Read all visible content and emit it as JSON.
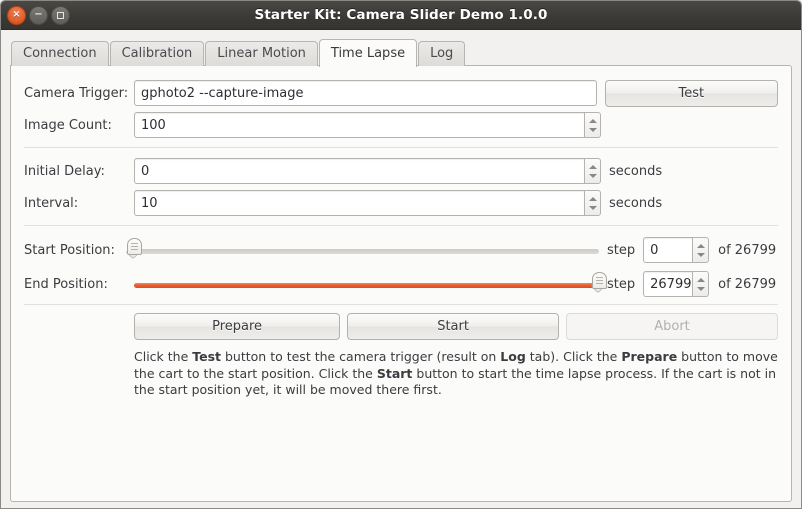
{
  "window": {
    "title": "Starter Kit: Camera Slider Demo 1.0.0",
    "controls": {
      "close": "×",
      "minimize": "−",
      "maximize": "□"
    }
  },
  "tabs": [
    {
      "label": "Connection",
      "active": false
    },
    {
      "label": "Calibration",
      "active": false
    },
    {
      "label": "Linear Motion",
      "active": false
    },
    {
      "label": "Time Lapse",
      "active": true
    },
    {
      "label": "Log",
      "active": false
    }
  ],
  "form": {
    "camera_trigger": {
      "label": "Camera Trigger:",
      "value": "gphoto2 --capture-image",
      "test_button": "Test"
    },
    "image_count": {
      "label": "Image Count:",
      "value": "100"
    },
    "initial_delay": {
      "label": "Initial Delay:",
      "value": "0",
      "unit": "seconds"
    },
    "interval": {
      "label": "Interval:",
      "value": "10",
      "unit": "seconds"
    },
    "start_position": {
      "label": "Start Position:",
      "step_label": "step",
      "value": "0",
      "max_label": "of 26799",
      "slider_percent": 0
    },
    "end_position": {
      "label": "End Position:",
      "step_label": "step",
      "value": "26799",
      "max_label": "of 26799",
      "slider_percent": 100
    }
  },
  "actions": {
    "prepare": "Prepare",
    "start": "Start",
    "abort": "Abort"
  },
  "help": {
    "p1": "Click the ",
    "b1": "Test",
    "p2": " button to test the camera trigger (result on ",
    "b2": "Log",
    "p3": " tab). Click the ",
    "b3": "Prepare",
    "p4": " button to move the cart to the start position. Click the ",
    "b4": "Start",
    "p5": " button to start the time lapse process. If the cart is not in the start position yet, it will be moved there first."
  },
  "colors": {
    "accent_orange": "#e85a2c",
    "titlebar": "#3a3936",
    "panel": "#fbfbfa",
    "text": "#3c3c40"
  }
}
